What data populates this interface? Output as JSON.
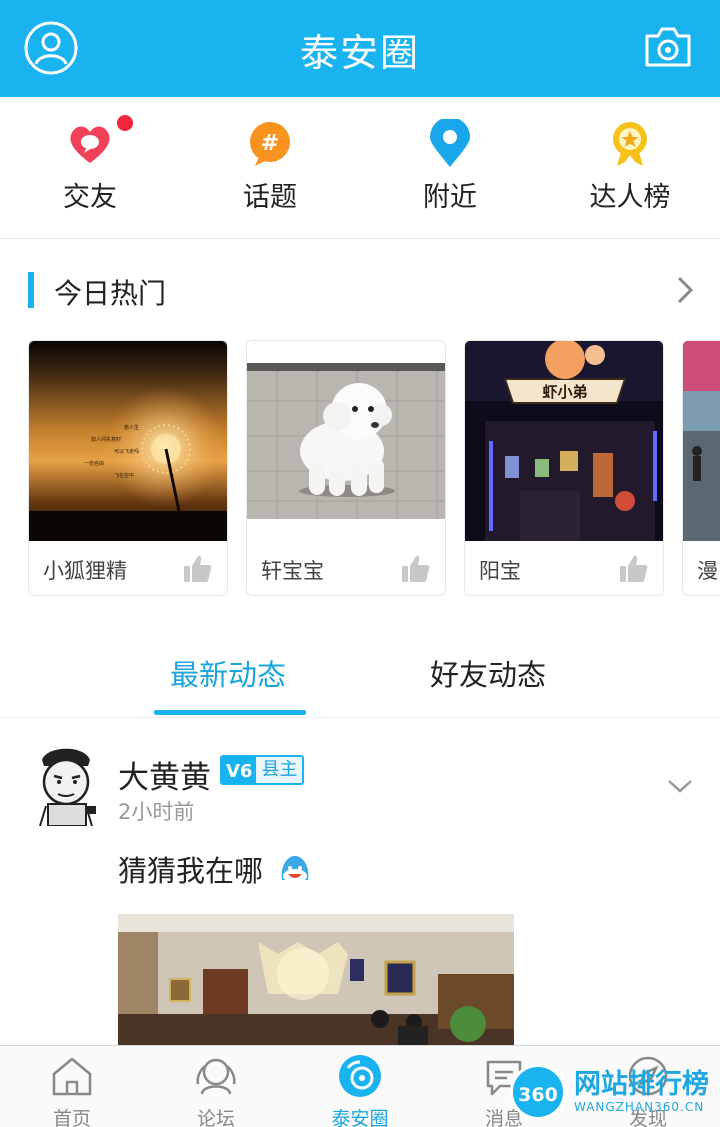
{
  "header": {
    "title": "泰安圈"
  },
  "quick": [
    {
      "label": "交友",
      "icon": "heart-chat-icon",
      "badge": true
    },
    {
      "label": "话题",
      "icon": "hashtag-bubble-icon"
    },
    {
      "label": "附近",
      "icon": "location-pin-icon"
    },
    {
      "label": "达人榜",
      "icon": "medal-icon"
    }
  ],
  "hot": {
    "title": "今日热门",
    "cards": [
      {
        "name": "小狐狸精"
      },
      {
        "name": "轩宝宝"
      },
      {
        "name": "阳宝"
      },
      {
        "name": "漫"
      }
    ],
    "photo_texts": {
      "dandelion": [
        "若人生",
        "如人间失意时",
        "可以飞走吗",
        "一份自由",
        "飞在空中"
      ],
      "shop_sign": "虾小弟"
    }
  },
  "tabs": [
    {
      "label": "最新动态",
      "active": true
    },
    {
      "label": "好友动态",
      "active": false
    }
  ],
  "post": {
    "user": "大黄黄",
    "level": "V6",
    "title": "县主",
    "time": "2小时前",
    "text": "猜猜我在哪"
  },
  "bottom_nav": [
    {
      "label": "首页",
      "icon": "home-icon",
      "active": false
    },
    {
      "label": "论坛",
      "icon": "forum-icon",
      "active": false
    },
    {
      "label": "泰安圈",
      "icon": "circle-icon",
      "active": true
    },
    {
      "label": "消息",
      "icon": "message-icon",
      "active": false
    },
    {
      "label": "发现",
      "icon": "discover-icon",
      "active": false
    }
  ],
  "watermark": {
    "circle": "360",
    "text": "网站排行榜",
    "sub": "WANGZHAN360.CN"
  },
  "colors": {
    "accent": "#19b4ef",
    "badge": "#f2253d"
  }
}
